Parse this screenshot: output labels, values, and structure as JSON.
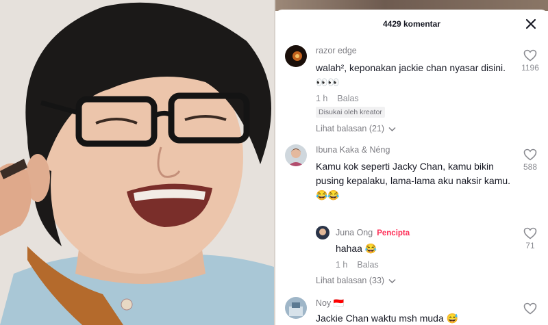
{
  "panel": {
    "comment_count_title": "4429 komentar"
  },
  "comments": [
    {
      "username": "razor edge",
      "text": "walah², keponakan jackie chan nyasar disini. 👀👀",
      "time": "1 h",
      "reply_label": "Balas",
      "badge": "Disukai oleh kreator",
      "likes": "1196",
      "view_replies": "Lihat balasan (21)"
    },
    {
      "username": "Ibuna Kaka & Néng",
      "text": "Kamu kok seperti Jacky Chan, kamu bikin pusing kepalaku, lama-lama aku naksir kamu. 😂😂",
      "likes": "588",
      "reply": {
        "username": "Juna Ong",
        "role": "Pencipta",
        "text": "hahaa 😂",
        "time": "1 h",
        "reply_label": "Balas",
        "likes": "71"
      },
      "view_replies": "Lihat balasan (33)"
    },
    {
      "username": "Noy 🇮🇩",
      "text": "Jackie Chan waktu msh muda 😅"
    }
  ],
  "icons": {
    "close": "close-icon",
    "like": "heart-outline-icon",
    "chevron": "chevron-down-icon"
  },
  "colors": {
    "creator_tag": "#fe2c55",
    "muted_text": "#8a8b91",
    "body_text": "#161823"
  }
}
